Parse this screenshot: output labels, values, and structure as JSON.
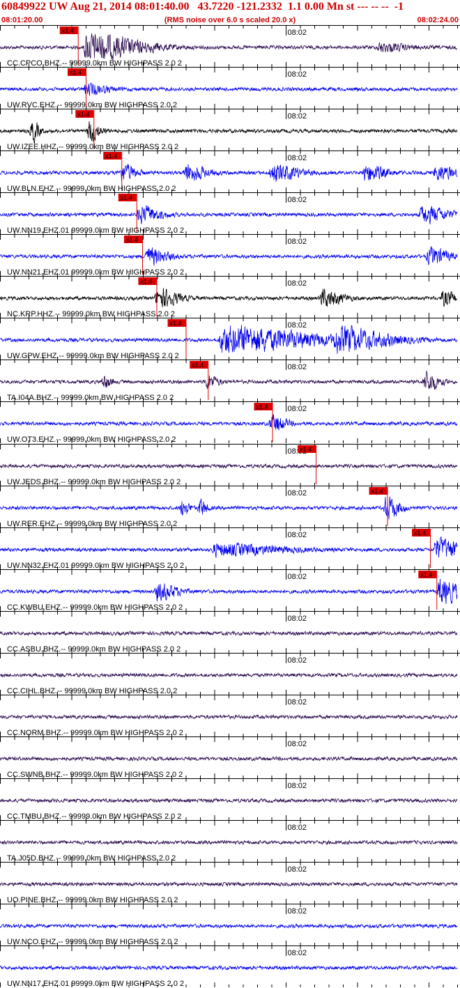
{
  "header": {
    "title": "60849922 UW Aug 21, 2014 08:01:40.00   43.7220 -121.2332  1.1 0.00 Mn st --- -- --  -1",
    "start_time": "08:01:20.00",
    "note": "(RMS noise over 6.0 s scaled 20.0 x)",
    "end_time": "08:02:24.00"
  },
  "colors": {
    "title": "#cc0000",
    "pick": "#dd0000",
    "grid": "#000000",
    "trace_blue": "#0000ee",
    "trace_black": "#000000",
    "trace_purple": "#2a0a4e"
  },
  "chart_data": {
    "type": "line",
    "x_start": "08:01:20.00",
    "x_end": "08:02:24.00",
    "x_range_seconds": [
      0,
      64
    ],
    "tick_label": "08:02",
    "tick_label_time_s": 40,
    "tick_interval_s": 2,
    "pick_label": "x1.4",
    "traces": [
      {
        "label": "CC.CPCO.BHZ.-- 99999.0km BW  HIGHPASS  2.0  2",
        "color": "purple",
        "pick_s": 10.9,
        "events": [
          {
            "t": 12,
            "a": 1.0,
            "d": 8
          },
          {
            "t": 53,
            "a": 0.3,
            "d": 4
          }
        ]
      },
      {
        "label": "UW.RVC.EHZ.-- 99999.0km BW  HIGHPASS  2.0  2",
        "color": "blue",
        "pick_s": 12.0,
        "events": [
          {
            "t": 12,
            "a": 0.4,
            "d": 3
          }
        ]
      },
      {
        "label": "UW.IZEE.HHZ.-- 99999.0km BW  HIGHPASS  2.0  2",
        "color": "black",
        "pick_s": 13.1,
        "events": [
          {
            "t": 4.5,
            "a": 0.8,
            "d": 1
          },
          {
            "t": 12.5,
            "a": 0.8,
            "d": 1.5
          }
        ]
      },
      {
        "label": "UW.BLN.EHZ.-- 99999.0km BW  HIGHPASS  2.0  2",
        "color": "blue",
        "pick_s": 17.0,
        "events": [
          {
            "t": 17,
            "a": 0.6,
            "d": 2
          },
          {
            "t": 26,
            "a": 0.6,
            "d": 3
          },
          {
            "t": 38,
            "a": 0.6,
            "d": 4
          },
          {
            "t": 51,
            "a": 0.6,
            "d": 3
          },
          {
            "t": 61,
            "a": 0.5,
            "d": 3
          }
        ]
      },
      {
        "label": "UW.NN19.EHZ.01 99999.0km BW  HIGHPASS  2.0  2",
        "color": "blue",
        "pick_s": 19.1,
        "events": [
          {
            "t": 19.5,
            "a": 0.6,
            "d": 3
          },
          {
            "t": 59,
            "a": 0.6,
            "d": 4
          }
        ]
      },
      {
        "label": "UW.NN21.EHZ.01 99999.0km BW  HIGHPASS  2.0  2",
        "color": "blue",
        "pick_s": 19.9,
        "events": [
          {
            "t": 20.5,
            "a": 0.6,
            "d": 3
          },
          {
            "t": 60,
            "a": 0.6,
            "d": 3
          }
        ]
      },
      {
        "label": "NC.KRP.HHZ.-- 99999.0km BW  HIGHPASS  2.0  2",
        "color": "black",
        "pick_s": 21.9,
        "events": [
          {
            "t": 22,
            "a": 0.7,
            "d": 3
          },
          {
            "t": 45,
            "a": 0.6,
            "d": 3
          },
          {
            "t": 62,
            "a": 0.5,
            "d": 2
          }
        ]
      },
      {
        "label": "UW.GPW.EHZ.-- 99999.0km BW  HIGHPASS  2.0  2",
        "color": "blue",
        "pick_s": 26.0,
        "events": [
          {
            "t": 31,
            "a": 1.0,
            "d": 14
          },
          {
            "t": 47,
            "a": 0.7,
            "d": 8
          }
        ]
      },
      {
        "label": "TA.I04A.BHZ.-- 99999.0km BW  HIGHPASS  2.0  2",
        "color": "purple",
        "pick_s": 29.1,
        "events": [
          {
            "t": 14.5,
            "a": 0.5,
            "d": 1
          },
          {
            "t": 29,
            "a": 0.5,
            "d": 1.5
          },
          {
            "t": 59.5,
            "a": 0.7,
            "d": 2
          }
        ]
      },
      {
        "label": "UW.OT3.EHZ.-- 99999.0km BW  HIGHPASS  2.0  2",
        "color": "blue",
        "pick_s": 38.1,
        "events": [
          {
            "t": 38,
            "a": 0.6,
            "d": 2
          }
        ]
      },
      {
        "label": "UW.JEDS.BHZ.-- 99999.0km BW  HIGHPASS  2.0  2",
        "color": "purple",
        "pick_s": 44.2,
        "events": []
      },
      {
        "label": "UW.RER.EHZ.-- 99999.0km BW  HIGHPASS  2.0  2",
        "color": "blue",
        "pick_s": 54.2,
        "events": [
          {
            "t": 25.5,
            "a": 0.6,
            "d": 1
          },
          {
            "t": 28,
            "a": 0.6,
            "d": 1
          },
          {
            "t": 54,
            "a": 0.8,
            "d": 2
          }
        ]
      },
      {
        "label": "UW.NN32.EHZ.01 99999.0km BW  HIGHPASS  2.0  2",
        "color": "blue",
        "pick_s": 60.2,
        "events": [
          {
            "t": 30,
            "a": 0.4,
            "d": 10
          },
          {
            "t": 61,
            "a": 0.8,
            "d": 4
          }
        ]
      },
      {
        "label": "CC.KWBU.EHZ.-- 99999.0km BW  HIGHPASS  2.0  2",
        "color": "blue",
        "pick_s": 61.1,
        "events": [
          {
            "t": 22,
            "a": 0.6,
            "d": 3
          },
          {
            "t": 61.5,
            "a": 0.9,
            "d": 3
          }
        ]
      },
      {
        "label": "CC.ASBU.BHZ.-- 99999.0km BW  HIGHPASS  2.0  2",
        "color": "purple",
        "pick_s": null,
        "events": []
      },
      {
        "label": "CC.CIHL.BHZ.-- 99999.0km BW  HIGHPASS  2.0  2",
        "color": "purple",
        "pick_s": null,
        "events": []
      },
      {
        "label": "CC.NORM.BHZ.-- 99999.0km BW  HIGHPASS  2.0  2",
        "color": "purple",
        "pick_s": null,
        "events": []
      },
      {
        "label": "CC.SWNB.BHZ.-- 99999.0km BW  HIGHPASS  2.0  2",
        "color": "purple",
        "pick_s": null,
        "events": []
      },
      {
        "label": "CC.TMBU.BHZ.-- 99999.0km BW  HIGHPASS  2.0  2",
        "color": "purple",
        "pick_s": null,
        "events": []
      },
      {
        "label": "TA.J05D.BHZ.-- 99999.0km BW  HIGHPASS  2.0  2",
        "color": "purple",
        "pick_s": null,
        "events": []
      },
      {
        "label": "UO.PINE.BHZ.-- 99999.0km BW  HIGHPASS  2.0  2",
        "color": "purple",
        "pick_s": null,
        "events": []
      },
      {
        "label": "UW.NCO.EHZ.-- 99999.0km BW  HIGHPASS  2.0  2",
        "color": "blue",
        "pick_s": null,
        "events": []
      },
      {
        "label": "UW.NN17.EHZ.01 99999.0km BW  HIGHPASS  2.0  2",
        "color": "blue",
        "pick_s": null,
        "events": []
      }
    ]
  }
}
